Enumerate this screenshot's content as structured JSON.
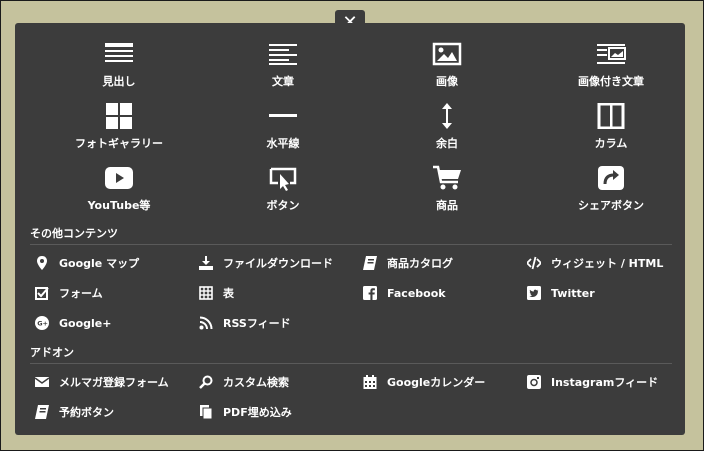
{
  "close_label": "✕",
  "tiles": [
    {
      "label": "見出し",
      "icon": "heading-icon"
    },
    {
      "label": "文章",
      "icon": "text-icon"
    },
    {
      "label": "画像",
      "icon": "image-icon"
    },
    {
      "label": "画像付き文章",
      "icon": "image-text-icon"
    },
    {
      "label": "フォトギャラリー",
      "icon": "gallery-icon"
    },
    {
      "label": "水平線",
      "icon": "horizontal-line-icon"
    },
    {
      "label": "余白",
      "icon": "spacer-icon"
    },
    {
      "label": "カラム",
      "icon": "columns-icon"
    },
    {
      "label": "YouTube等",
      "icon": "youtube-icon"
    },
    {
      "label": "ボタン",
      "icon": "button-icon"
    },
    {
      "label": "商品",
      "icon": "cart-icon"
    },
    {
      "label": "シェアボタン",
      "icon": "share-icon"
    }
  ],
  "other_contents": {
    "title": "その他コンテンツ",
    "items": [
      {
        "label": "Google マップ",
        "icon": "map-marker-icon"
      },
      {
        "label": "ファイルダウンロード",
        "icon": "download-icon"
      },
      {
        "label": "商品カタログ",
        "icon": "catalog-icon"
      },
      {
        "label": "ウィジェット / HTML",
        "icon": "code-icon"
      },
      {
        "label": "フォーム",
        "icon": "form-checkbox-icon"
      },
      {
        "label": "表",
        "icon": "table-icon"
      },
      {
        "label": "Facebook",
        "icon": "facebook-icon"
      },
      {
        "label": "Twitter",
        "icon": "twitter-icon"
      },
      {
        "label": "Google+",
        "icon": "google-plus-icon"
      },
      {
        "label": "RSSフィード",
        "icon": "rss-icon"
      }
    ]
  },
  "addons": {
    "title": "アドオン",
    "items": [
      {
        "label": "メルマガ登録フォーム",
        "icon": "mail-icon"
      },
      {
        "label": "カスタム検索",
        "icon": "search-icon"
      },
      {
        "label": "Googleカレンダー",
        "icon": "calendar-icon"
      },
      {
        "label": "Instagramフィード",
        "icon": "instagram-icon"
      },
      {
        "label": "予約ボタン",
        "icon": "reservation-book-icon"
      },
      {
        "label": "PDF埋め込み",
        "icon": "pdf-icon"
      }
    ]
  }
}
